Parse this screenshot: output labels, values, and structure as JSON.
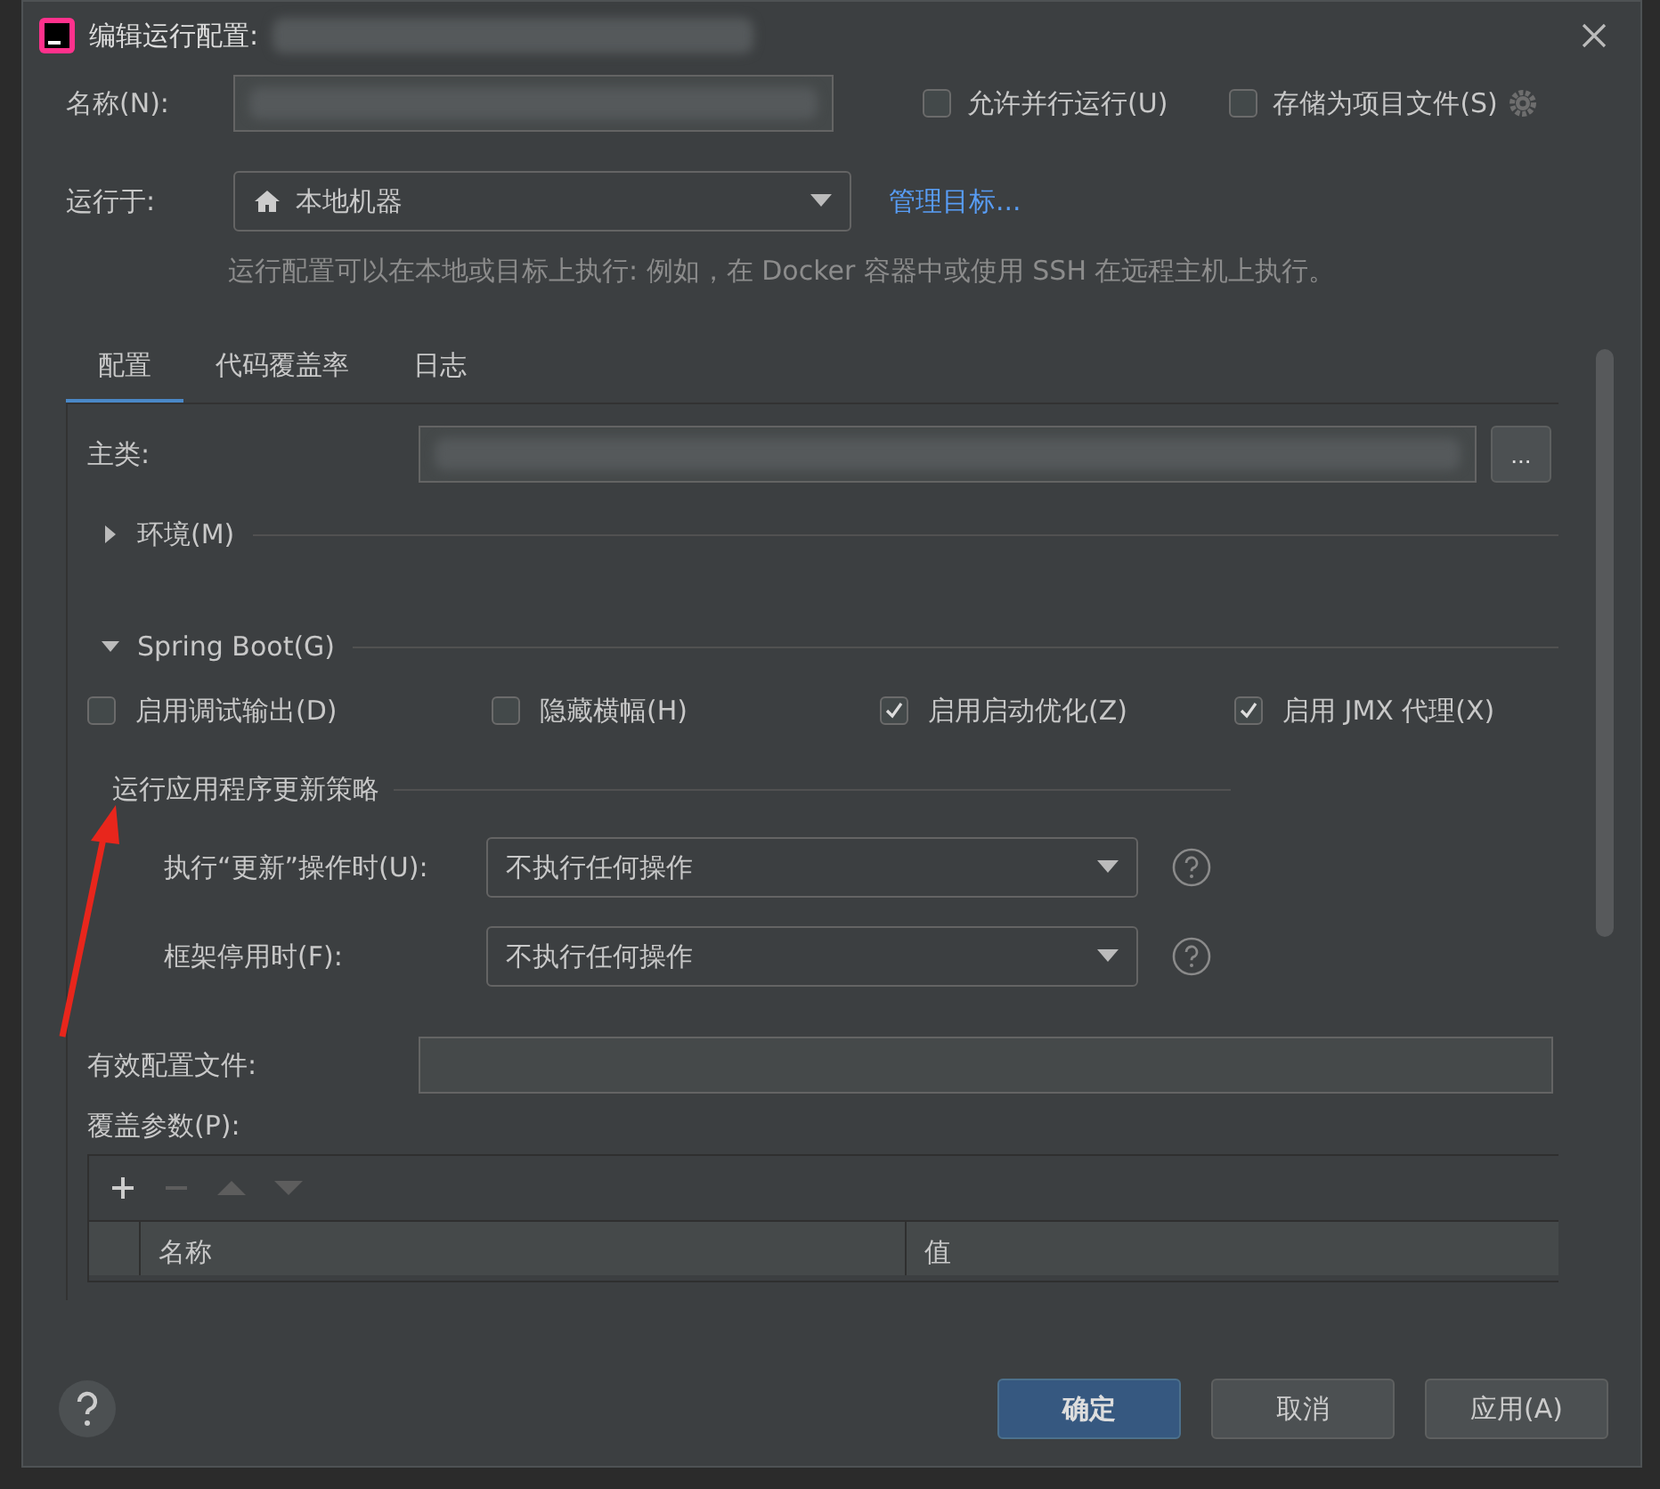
{
  "window": {
    "title": "编辑运行配置:"
  },
  "name_field": {
    "label": "名称(N):"
  },
  "options": [
    {
      "label": "允许并行运行(U)",
      "checked": false
    },
    {
      "label": "存储为项目文件(S)",
      "checked": false
    }
  ],
  "run_on": {
    "label": "运行于:",
    "value": "本地机器",
    "link": "管理目标..."
  },
  "hint": "运行配置可以在本地或目标上执行: 例如，在 Docker 容器中或使用 SSH 在远程主机上执行。",
  "tabs": [
    {
      "label": "配置",
      "selected": true
    },
    {
      "label": "代码覆盖率",
      "selected": false
    },
    {
      "label": "日志",
      "selected": false
    }
  ],
  "main_class": {
    "label": "主类:",
    "button": "..."
  },
  "sections": [
    {
      "label": "环境(M)",
      "expanded": false
    },
    {
      "label": "Spring Boot(G)",
      "expanded": true
    }
  ],
  "spring_options": [
    {
      "label": "启用调试输出(D)",
      "checked": false
    },
    {
      "label": "隐藏横幅(H)",
      "checked": false
    },
    {
      "label": "启用启动优化(Z)",
      "checked": true
    },
    {
      "label": "启用 JMX 代理(X)",
      "checked": true
    }
  ],
  "update_policy": {
    "title": "运行应用程序更新策略",
    "rows": [
      {
        "label": "执行“更新”操作时(U):",
        "value": "不执行任何操作"
      },
      {
        "label": "框架停用时(F):",
        "value": "不执行任何操作"
      }
    ]
  },
  "active_profiles": {
    "label": "有效配置文件:"
  },
  "override_params": {
    "label": "覆盖参数(P):",
    "columns": [
      "名称",
      "值"
    ]
  },
  "buttons": [
    {
      "label": "确定",
      "primary": true
    },
    {
      "label": "取消",
      "primary": false
    },
    {
      "label": "应用(A)",
      "primary": false
    }
  ]
}
